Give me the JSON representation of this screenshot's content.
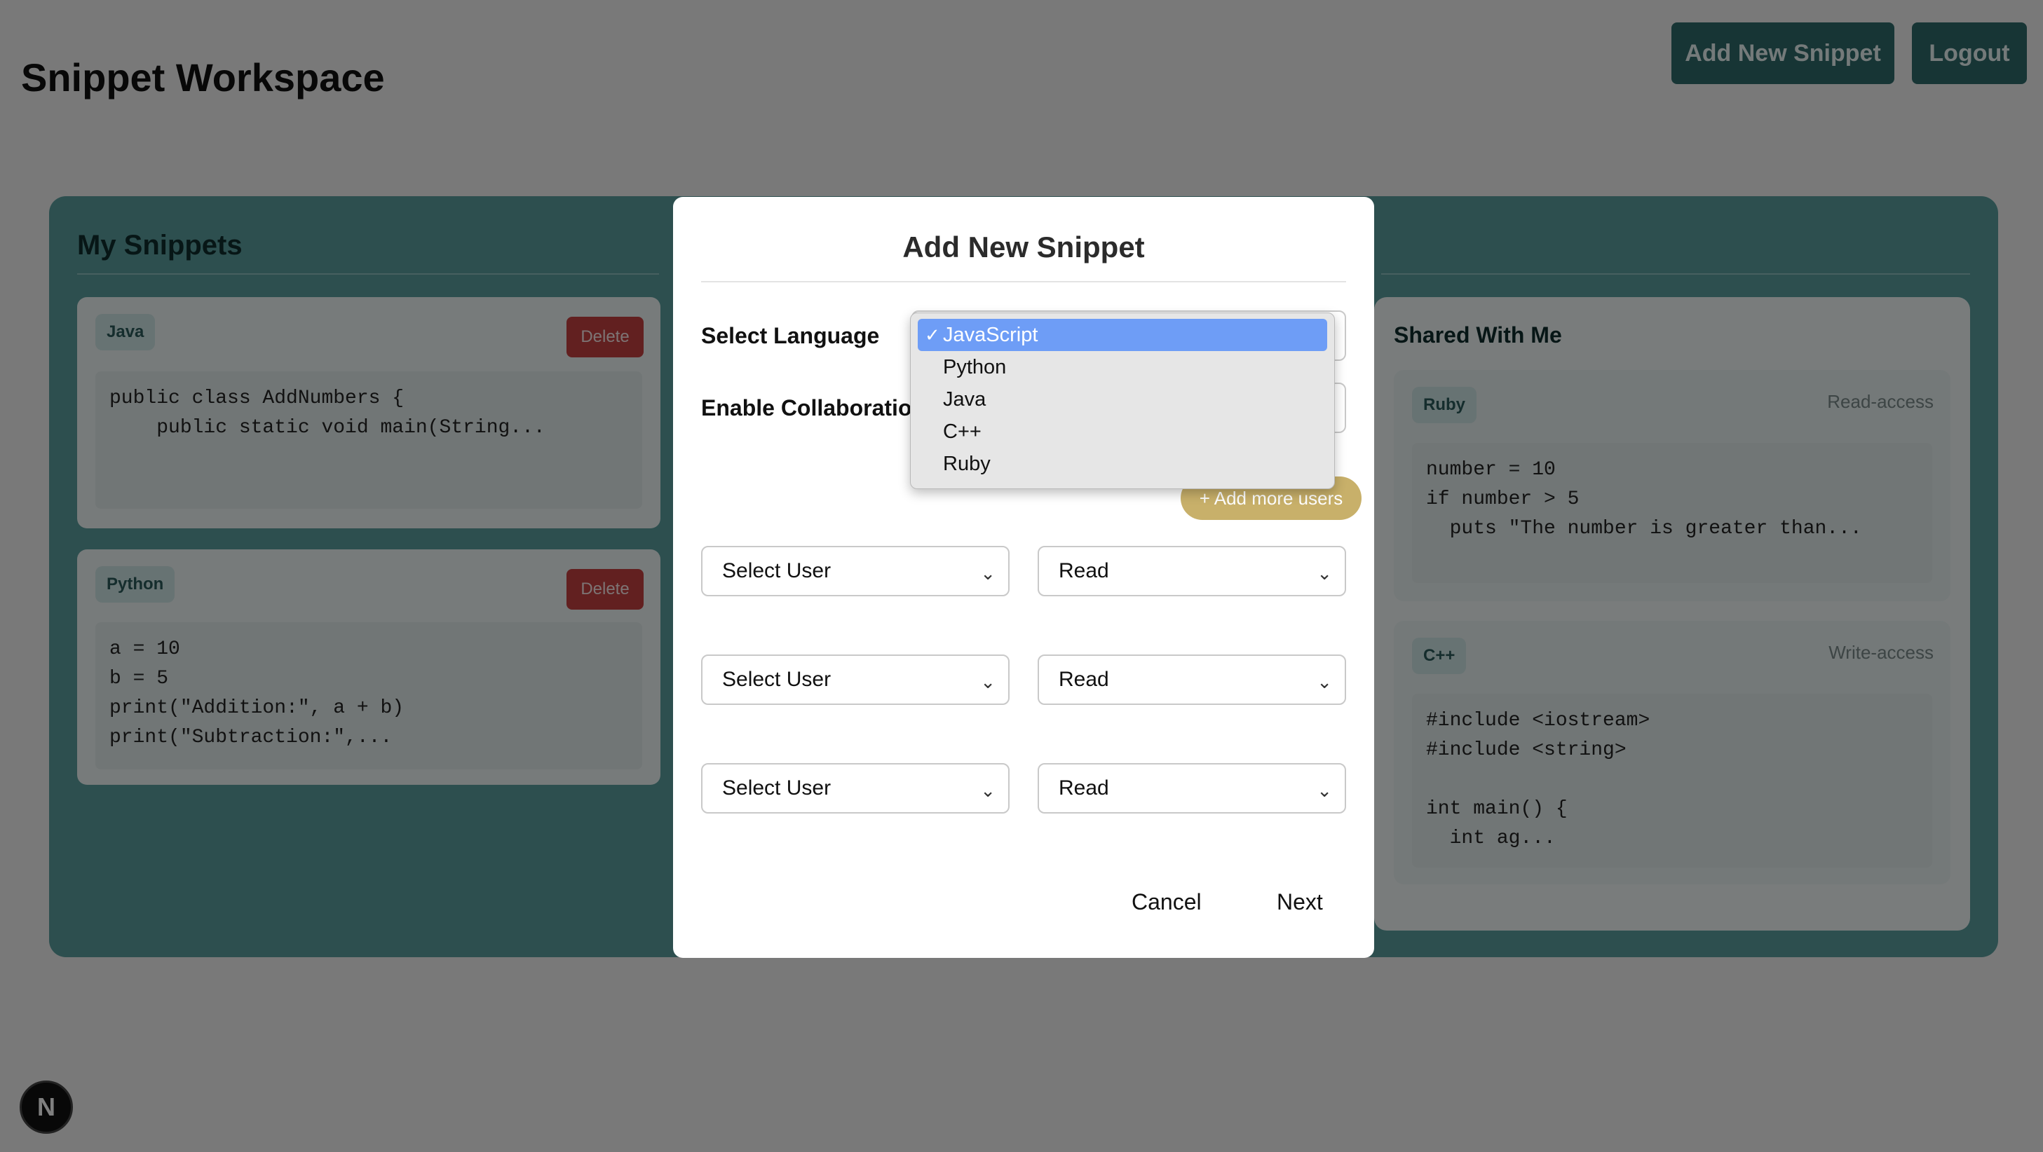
{
  "header": {
    "title": "Snippet Workspace",
    "add_button": "Add New Snippet",
    "logout_button": "Logout"
  },
  "my_snippets": {
    "title": "My Snippets",
    "delete_label": "Delete",
    "items": [
      {
        "language": "Java",
        "code": "public class AddNumbers {\n    public static void main(String..."
      },
      {
        "language": "Python",
        "code": "a = 10\nb = 5\nprint(\"Addition:\", a + b)\nprint(\"Subtraction:\",..."
      }
    ]
  },
  "shared": {
    "title": "Shared With Me",
    "items": [
      {
        "language": "Ruby",
        "access": "Read-access",
        "code": "number = 10\nif number > 5\n  puts \"The number is greater than..."
      },
      {
        "language": "C++",
        "access": "Write-access",
        "code": "#include <iostream>\n#include <string>\n\nint main() {\n  int ag..."
      }
    ]
  },
  "modal": {
    "title": "Add New Snippet",
    "language_label": "Select Language",
    "collab_label": "Enable Collaboration",
    "add_users_label": "+ Add more users",
    "user_rows": [
      {
        "user": "Select User",
        "permission": "Read"
      },
      {
        "user": "Select User",
        "permission": "Read"
      },
      {
        "user": "Select User",
        "permission": "Read"
      }
    ],
    "cancel": "Cancel",
    "next": "Next"
  },
  "language_dropdown": {
    "selected": "JavaScript",
    "options": [
      "JavaScript",
      "Python",
      "Java",
      "C++",
      "Ruby"
    ]
  },
  "badge": {
    "letter": "N"
  },
  "colors": {
    "primary": "#2f6b6b",
    "panel": "#5a9e9e",
    "danger": "#c44141",
    "pill": "#c8b06a",
    "selected_option": "#6e9df6"
  }
}
